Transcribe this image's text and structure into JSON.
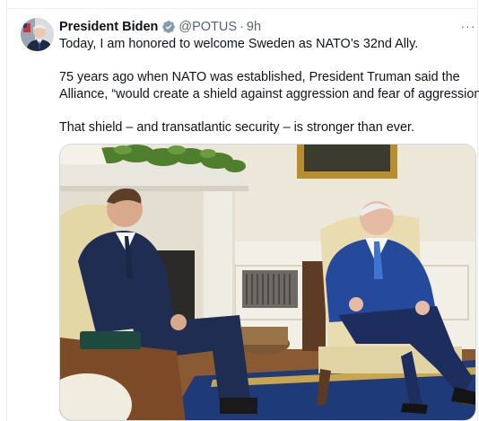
{
  "tweet": {
    "display_name": "President Biden",
    "handle": "@POTUS",
    "separator": "·",
    "timestamp": "9h",
    "paragraphs": [
      "Today, I am honored to welcome Sweden as NATO’s 32nd Ally.",
      "75 years ago when NATO was established, President Truman said the Alliance, “would create a shield against aggression and fear of aggression.”",
      "That shield – and transatlantic security – is stronger than ever."
    ],
    "text_lines": {
      "line1": "Today, I am honored to welcome Sweden as NATO’s 32nd Ally.",
      "line2": "75 years ago when NATO was established, President Truman said the",
      "line3": "Alliance, “would create a shield against aggression and fear of aggression.”",
      "line4": "That shield – and transatlantic security – is stronger than ever."
    },
    "more_label": "···",
    "icons": {
      "verified": "verified-badge-icon",
      "more": "more-options-icon"
    },
    "colors": {
      "verified_badge": "#829aab",
      "name_text": "#0f1419",
      "secondary_text": "#536471"
    }
  }
}
